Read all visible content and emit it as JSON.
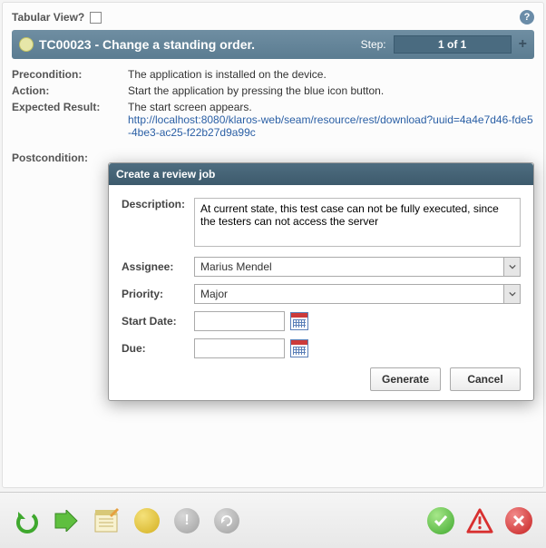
{
  "header": {
    "tabular_label": "Tabular View?",
    "title": "TC00023 - Change a standing order.",
    "step_label": "Step:",
    "step_value": "1 of 1"
  },
  "details": {
    "precondition_label": "Precondition:",
    "precondition_value": "The application is installed on the device.",
    "action_label": "Action:",
    "action_value": "Start the application by pressing the blue icon button.",
    "expected_label": "Expected Result:",
    "expected_text": "The start screen appears.",
    "expected_url": "http://localhost:8080/klaros-web/seam/resource/rest/download?uuid=4a4e7d46-fde5-4be3-ac25-f22b27d9a99c",
    "postcondition_label": "Postcondition:"
  },
  "dialog": {
    "title": "Create a review job",
    "description_label": "Description:",
    "description_value": "At current state, this test case can not be fully executed, since the testers can not access the server",
    "assignee_label": "Assignee:",
    "assignee_value": "Marius Mendel",
    "priority_label": "Priority:",
    "priority_value": "Major",
    "startdate_label": "Start Date:",
    "startdate_value": "",
    "due_label": "Due:",
    "due_value": "",
    "generate_label": "Generate",
    "cancel_label": "Cancel"
  }
}
